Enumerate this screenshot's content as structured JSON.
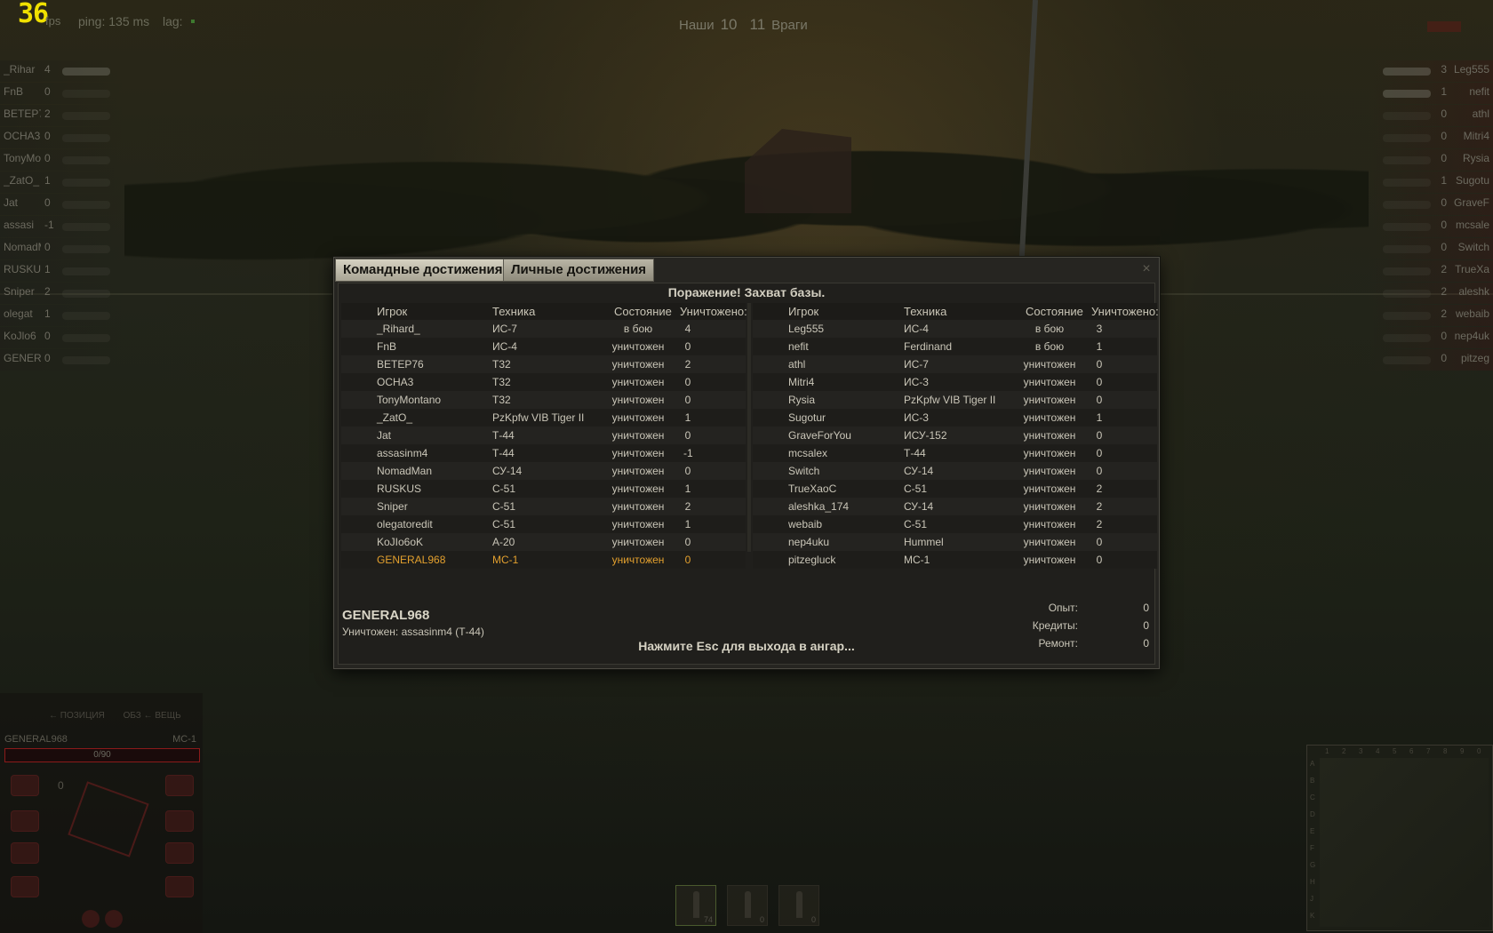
{
  "hud": {
    "fps_value": "36",
    "fps_unit": "fps",
    "ping": "ping: 135 ms",
    "lag": "lag:",
    "score": {
      "ours_label": "Наши",
      "ours": "10",
      "theirs": "11",
      "theirs_label": "Враги"
    }
  },
  "side_left": [
    {
      "name": "_Rihar",
      "frags": "4",
      "alive": true
    },
    {
      "name": "FnB",
      "frags": "0",
      "alive": false
    },
    {
      "name": "BETEP7",
      "frags": "2",
      "alive": false
    },
    {
      "name": "OCHA3",
      "frags": "0",
      "alive": false
    },
    {
      "name": "TonyMo",
      "frags": "0",
      "alive": false
    },
    {
      "name": "_ZatO_",
      "frags": "1",
      "alive": false
    },
    {
      "name": "Jat",
      "frags": "0",
      "alive": false
    },
    {
      "name": "assasi",
      "frags": "-1",
      "alive": false
    },
    {
      "name": "NomadM",
      "frags": "0",
      "alive": false
    },
    {
      "name": "RUSKUS",
      "frags": "1",
      "alive": false
    },
    {
      "name": "Sniper",
      "frags": "2",
      "alive": false
    },
    {
      "name": "olegat",
      "frags": "1",
      "alive": false
    },
    {
      "name": "KoJlo6",
      "frags": "0",
      "alive": false
    },
    {
      "name": "GENERA",
      "frags": "0",
      "alive": false
    }
  ],
  "side_right": [
    {
      "name": "Leg555",
      "frags": "3",
      "alive": true
    },
    {
      "name": "nefit",
      "frags": "1",
      "alive": true
    },
    {
      "name": "athl",
      "frags": "0",
      "alive": false
    },
    {
      "name": "Mitri4",
      "frags": "0",
      "alive": false
    },
    {
      "name": "Rysia",
      "frags": "0",
      "alive": false
    },
    {
      "name": "Sugotu",
      "frags": "1",
      "alive": false
    },
    {
      "name": "GraveF",
      "frags": "0",
      "alive": false
    },
    {
      "name": "mcsale",
      "frags": "0",
      "alive": false
    },
    {
      "name": "Switch",
      "frags": "0",
      "alive": false
    },
    {
      "name": "TrueXa",
      "frags": "2",
      "alive": false
    },
    {
      "name": "aleshk",
      "frags": "2",
      "alive": false
    },
    {
      "name": "webaib",
      "frags": "2",
      "alive": false
    },
    {
      "name": "nep4uk",
      "frags": "0",
      "alive": false
    },
    {
      "name": "pitzeg",
      "frags": "0",
      "alive": false
    }
  ],
  "damage_panel": {
    "tab1": "← ПОЗИЦИЯ",
    "tab2": "ОБЗ ← ВЕЩЬ",
    "player": "GENERAL968",
    "vehicle": "МС-1",
    "hp": "0/90",
    "counter": "0"
  },
  "shells": [
    {
      "count": "74",
      "selected": true
    },
    {
      "count": "0",
      "selected": false
    },
    {
      "count": "0",
      "selected": false
    }
  ],
  "minimap": {
    "cols": [
      "1",
      "2",
      "3",
      "4",
      "5",
      "6",
      "7",
      "8",
      "9",
      "0"
    ],
    "rows": [
      "A",
      "B",
      "C",
      "D",
      "E",
      "F",
      "G",
      "H",
      "J",
      "K"
    ]
  },
  "results": {
    "tab_team": "Командные достижения",
    "tab_personal": "Личные достижения",
    "close_icon": "×",
    "headline": "Поражение! Захват базы.",
    "columns": {
      "player": "Игрок",
      "vehicle": "Техника",
      "state": "Состояние",
      "kills": "Уничтожено:"
    },
    "team_ours": [
      {
        "player": "_Rihard_",
        "vehicle": "ИС-7",
        "state": "в бою",
        "kills": "4"
      },
      {
        "player": "FnB",
        "vehicle": "ИС-4",
        "state": "уничтожен",
        "kills": "0"
      },
      {
        "player": "BETEP76",
        "vehicle": "T32",
        "state": "уничтожен",
        "kills": "2"
      },
      {
        "player": "OCHA3",
        "vehicle": "T32",
        "state": "уничтожен",
        "kills": "0"
      },
      {
        "player": "TonyMontano",
        "vehicle": "T32",
        "state": "уничтожен",
        "kills": "0"
      },
      {
        "player": "_ZatO_",
        "vehicle": "PzKpfw VIB Tiger II",
        "state": "уничтожен",
        "kills": "1"
      },
      {
        "player": "Jat",
        "vehicle": "Т-44",
        "state": "уничтожен",
        "kills": "0"
      },
      {
        "player": "assasinm4",
        "vehicle": "Т-44",
        "state": "уничтожен",
        "kills": "-1"
      },
      {
        "player": "NomadMan",
        "vehicle": "СУ-14",
        "state": "уничтожен",
        "kills": "0"
      },
      {
        "player": "RUSKUS",
        "vehicle": "С-51",
        "state": "уничтожен",
        "kills": "1"
      },
      {
        "player": "Sniper",
        "vehicle": "С-51",
        "state": "уничтожен",
        "kills": "2"
      },
      {
        "player": "olegatoredit",
        "vehicle": "С-51",
        "state": "уничтожен",
        "kills": "1"
      },
      {
        "player": "KoJIo6oK",
        "vehicle": "А-20",
        "state": "уничтожен",
        "kills": "0"
      },
      {
        "player": "GENERAL968",
        "vehicle": "МС-1",
        "state": "уничтожен",
        "kills": "0",
        "me": true
      }
    ],
    "team_enemy": [
      {
        "player": "Leg555",
        "vehicle": "ИС-4",
        "state": "в бою",
        "kills": "3"
      },
      {
        "player": "nefit",
        "vehicle": "Ferdinand",
        "state": "в бою",
        "kills": "1"
      },
      {
        "player": "athl",
        "vehicle": "ИС-7",
        "state": "уничтожен",
        "kills": "0"
      },
      {
        "player": "Mitri4",
        "vehicle": "ИС-3",
        "state": "уничтожен",
        "kills": "0"
      },
      {
        "player": "Rysia",
        "vehicle": "PzKpfw VIB Tiger II",
        "state": "уничтожен",
        "kills": "0"
      },
      {
        "player": "Sugotur",
        "vehicle": "ИС-3",
        "state": "уничтожен",
        "kills": "1"
      },
      {
        "player": "GraveForYou",
        "vehicle": "ИСУ-152",
        "state": "уничтожен",
        "kills": "0"
      },
      {
        "player": "mcsalex",
        "vehicle": "Т-44",
        "state": "уничтожен",
        "kills": "0"
      },
      {
        "player": "Switch",
        "vehicle": "СУ-14",
        "state": "уничтожен",
        "kills": "0"
      },
      {
        "player": "TrueXaoC",
        "vehicle": "С-51",
        "state": "уничтожен",
        "kills": "2"
      },
      {
        "player": "aleshka_174",
        "vehicle": "СУ-14",
        "state": "уничтожен",
        "kills": "2"
      },
      {
        "player": "webaib",
        "vehicle": "С-51",
        "state": "уничтожен",
        "kills": "2"
      },
      {
        "player": "nep4uku",
        "vehicle": "Hummel",
        "state": "уничтожен",
        "kills": "0"
      },
      {
        "player": "pitzegluck",
        "vehicle": "МС-1",
        "state": "уничтожен",
        "kills": "0"
      }
    ],
    "player_name": "GENERAL968",
    "killed_by": "Уничтожен: assasinm4 (Т-44)",
    "esc_hint": "Нажмите Esc для выхода в ангар...",
    "stats": [
      {
        "label": "Опыт:",
        "value": "0"
      },
      {
        "label": "Кредиты:",
        "value": "0"
      },
      {
        "label": "Ремонт:",
        "value": "0"
      }
    ]
  }
}
